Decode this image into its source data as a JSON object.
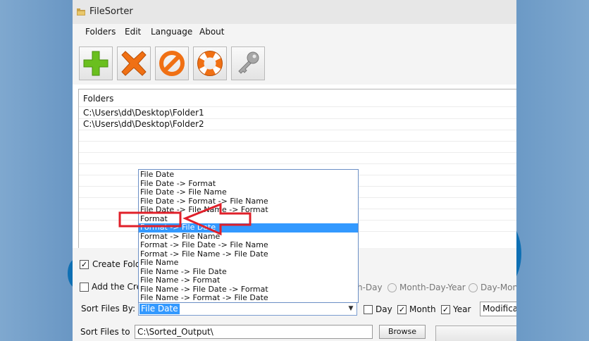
{
  "app": {
    "title": "FileSorter"
  },
  "menu": [
    "Folders",
    "Edit",
    "Language",
    "About"
  ],
  "toolbar": [
    {
      "icon": "add-icon",
      "color": "#6abf1e"
    },
    {
      "icon": "remove-icon",
      "color": "#f07014"
    },
    {
      "icon": "cancel-icon",
      "color": "#f07014"
    },
    {
      "icon": "lifebuoy-icon",
      "color": "#f07014"
    },
    {
      "icon": "key-icon",
      "color": "#9a9a9a"
    }
  ],
  "folders": {
    "header": "Folders",
    "items": [
      "C:\\Users\\dd\\Desktop\\Folder1",
      "C:\\Users\\dd\\Desktop\\Folder2"
    ]
  },
  "options": {
    "create_folders_label": "Create Fold",
    "create_folders_checked": true,
    "add_label": "Add the Cre",
    "add_checked": false,
    "date_formats": [
      "h-Day",
      "Month-Day-Year",
      "Day-Mont"
    ],
    "sort_by_label": "Sort Files By:",
    "sort_by_value": "File Date",
    "day_label": "Day",
    "day_checked": false,
    "month_label": "Month",
    "month_checked": true,
    "year_label": "Year",
    "year_checked": true,
    "date_type_value": "Modificat",
    "sort_to_label": "Sort Files to",
    "sort_to_value": "C:\\Sorted_Output\\",
    "browse_label": "Browse"
  },
  "dropdown": {
    "items": [
      "File Date",
      "File Date -> Format",
      "File Date -> File Name",
      "File Date -> Format -> File Name",
      "File Date -> File Name -> Format",
      "Format",
      "Format -> File Date",
      "Format -> File Name",
      "Format -> File Date -> File Name",
      "Format -> File Name -> File Date",
      "File Name",
      "File Name -> File Date",
      "File Name -> Format",
      "File Name -> File Date -> Format",
      "File Name -> Format -> File Date"
    ],
    "selected_index": 6,
    "highlighted_item": "Format"
  },
  "annotation": {
    "color": "#e0202a"
  }
}
